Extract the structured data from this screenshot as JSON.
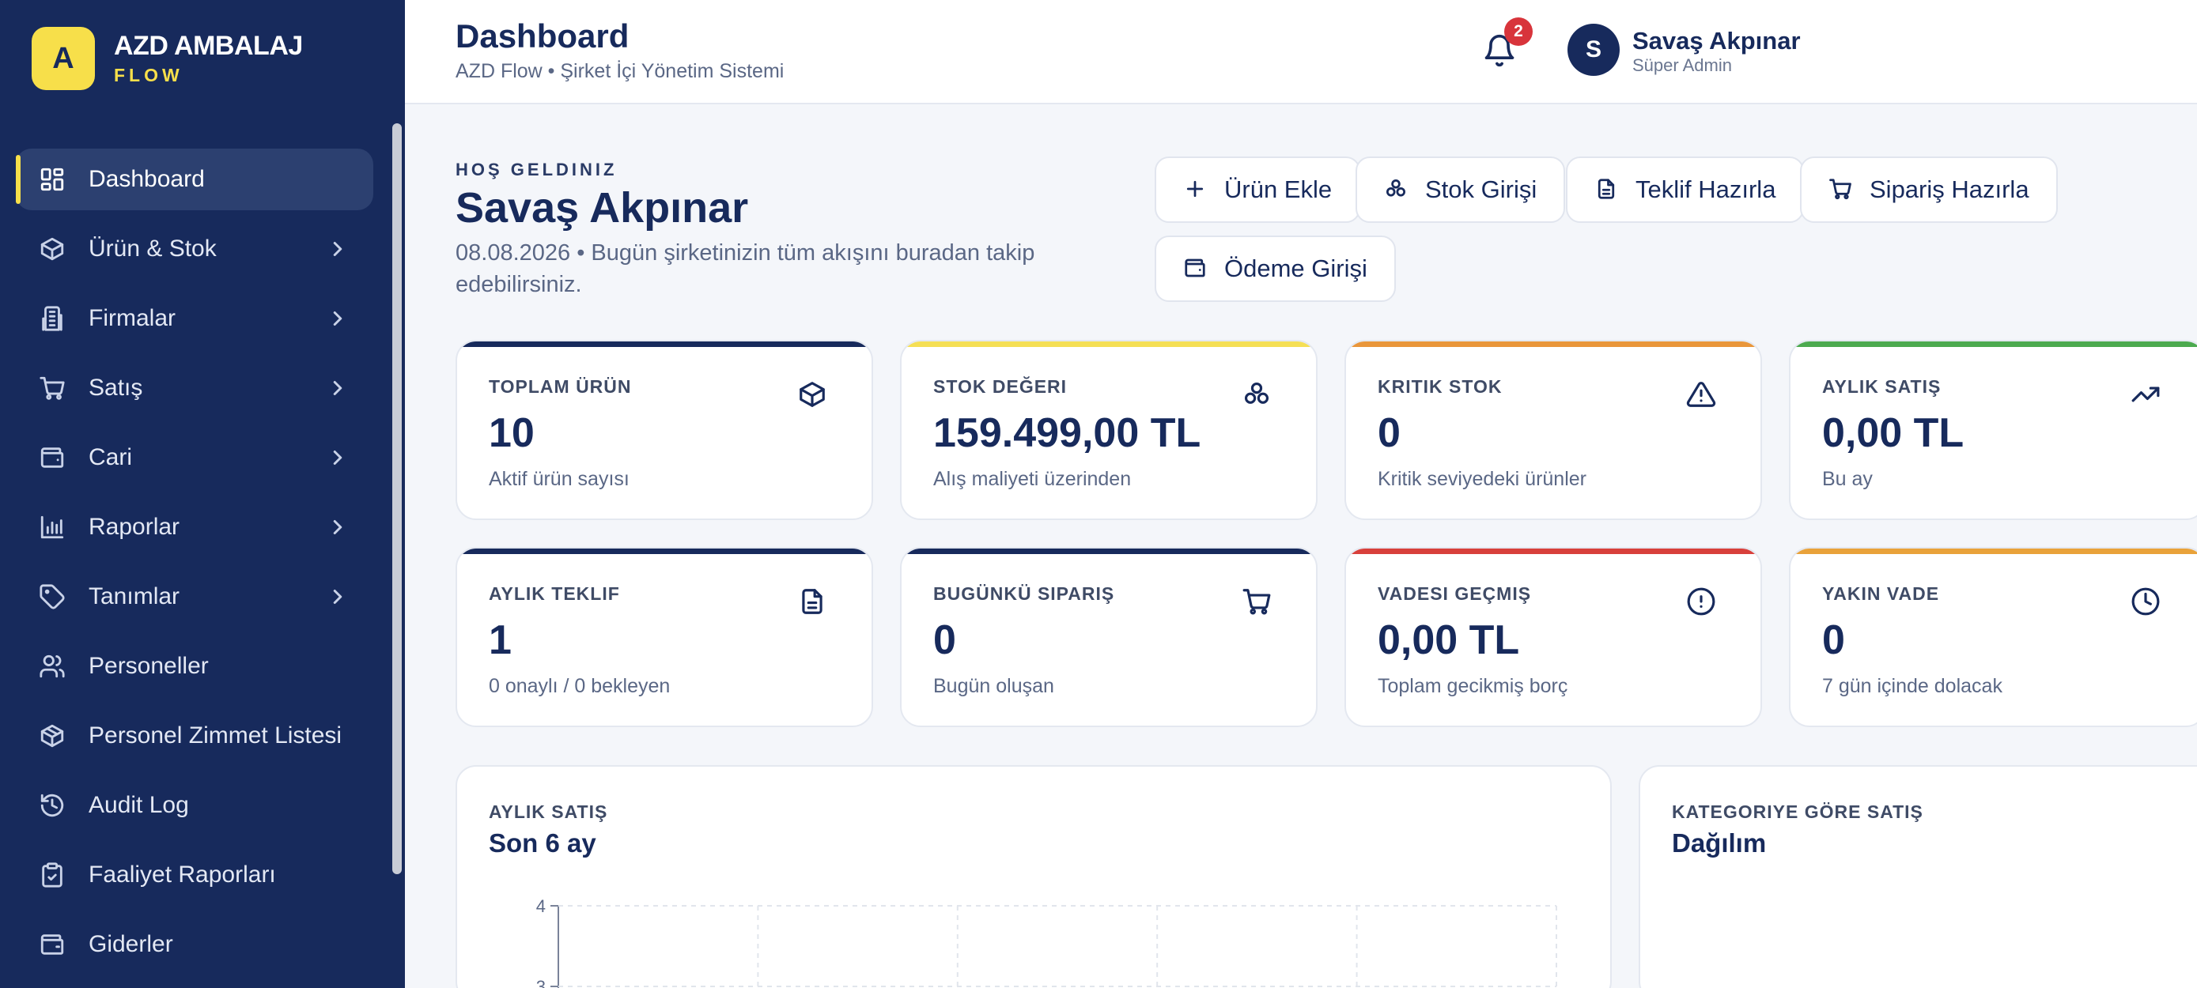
{
  "brand": {
    "logo_letter": "A",
    "name": "AZD AMBALAJ",
    "sub": "FLOW"
  },
  "sidebar": {
    "items": [
      {
        "label": "Dashboard",
        "icon": "dashboard-grid-icon",
        "active": true,
        "has_children": false
      },
      {
        "label": "Ürün & Stok",
        "icon": "box-icon",
        "has_children": true
      },
      {
        "label": "Firmalar",
        "icon": "building-icon",
        "has_children": true
      },
      {
        "label": "Satış",
        "icon": "cart-icon",
        "has_children": true
      },
      {
        "label": "Cari",
        "icon": "wallet-icon",
        "has_children": true
      },
      {
        "label": "Raporlar",
        "icon": "bar-chart-icon",
        "has_children": true
      },
      {
        "label": "Tanımlar",
        "icon": "tag-icon",
        "has_children": true
      },
      {
        "label": "Personeller",
        "icon": "users-icon",
        "has_children": false
      },
      {
        "label": "Personel Zimmet Listesi",
        "icon": "package-icon",
        "has_children": false
      },
      {
        "label": "Audit Log",
        "icon": "history-icon",
        "has_children": false
      },
      {
        "label": "Faaliyet Raporları",
        "icon": "clipboard-icon",
        "has_children": false
      },
      {
        "label": "Giderler",
        "icon": "receipt-icon",
        "has_children": false
      }
    ]
  },
  "header": {
    "title": "Dashboard",
    "subtitle": "AZD Flow • Şirket İçi Yönetim Sistemi",
    "notification_count": "2",
    "user": {
      "initial": "S",
      "name": "Savaş Akpınar",
      "role": "Süper Admin"
    }
  },
  "welcome": {
    "kicker": "HOŞ GELDINIZ",
    "name": "Savaş Akpınar",
    "description": "08.08.2026 • Bugün şirketinizin tüm akışını buradan takip edebilirsiniz."
  },
  "quick_actions": [
    {
      "label": "Ürün Ekle",
      "icon": "plus-icon"
    },
    {
      "label": "Stok Girişi",
      "icon": "boxes-icon"
    },
    {
      "label": "Teklif Hazırla",
      "icon": "document-icon"
    },
    {
      "label": "Sipariş Hazırla",
      "icon": "cart-icon"
    },
    {
      "label": "Ödeme Girişi",
      "icon": "wallet-icon"
    }
  ],
  "stats": [
    {
      "label": "TOPLAM ÜRÜN",
      "value": "10",
      "note": "Aktif ürün sayısı",
      "icon": "box-icon",
      "accent": "#172a5c"
    },
    {
      "label": "STOK DEĞERI",
      "value": "159.499,00 TL",
      "note": "Alış maliyeti üzerinden",
      "icon": "boxes-icon",
      "accent": "#f5df55"
    },
    {
      "label": "KRITIK STOK",
      "value": "0",
      "note": "Kritik seviyedeki ürünler",
      "icon": "warning-icon",
      "accent": "#e9963a"
    },
    {
      "label": "AYLIK SATIŞ",
      "value": "0,00 TL",
      "note": "Bu ay",
      "icon": "trend-up-icon",
      "accent": "#4caa4f"
    },
    {
      "label": "AYLIK TEKLIF",
      "value": "1",
      "note": "0 onaylı / 0 bekleyen",
      "icon": "document-icon",
      "accent": "#172a5c"
    },
    {
      "label": "BUGÜNKÜ SIPARIŞ",
      "value": "0",
      "note": "Bugün oluşan",
      "icon": "cart-icon",
      "accent": "#172a5c"
    },
    {
      "label": "VADESI GEÇMIŞ",
      "value": "0,00 TL",
      "note": "Toplam gecikmiş borç",
      "icon": "alert-circle-icon",
      "accent": "#d8403b"
    },
    {
      "label": "YAKIN VADE",
      "value": "0",
      "note": "7 gün içinde dolacak",
      "icon": "clock-icon",
      "accent": "#e9a23a"
    }
  ],
  "panels": {
    "monthly": {
      "label": "AYLIK SATIŞ",
      "title": "Son 6 ay"
    },
    "category": {
      "label": "KATEGORIYE GÖRE SATIŞ",
      "title": "Dağılım"
    }
  },
  "chart_data": {
    "type": "line",
    "title": "Son 6 ay",
    "y_ticks": [
      4,
      3
    ],
    "ylim": [
      0,
      4
    ],
    "grid": true
  }
}
